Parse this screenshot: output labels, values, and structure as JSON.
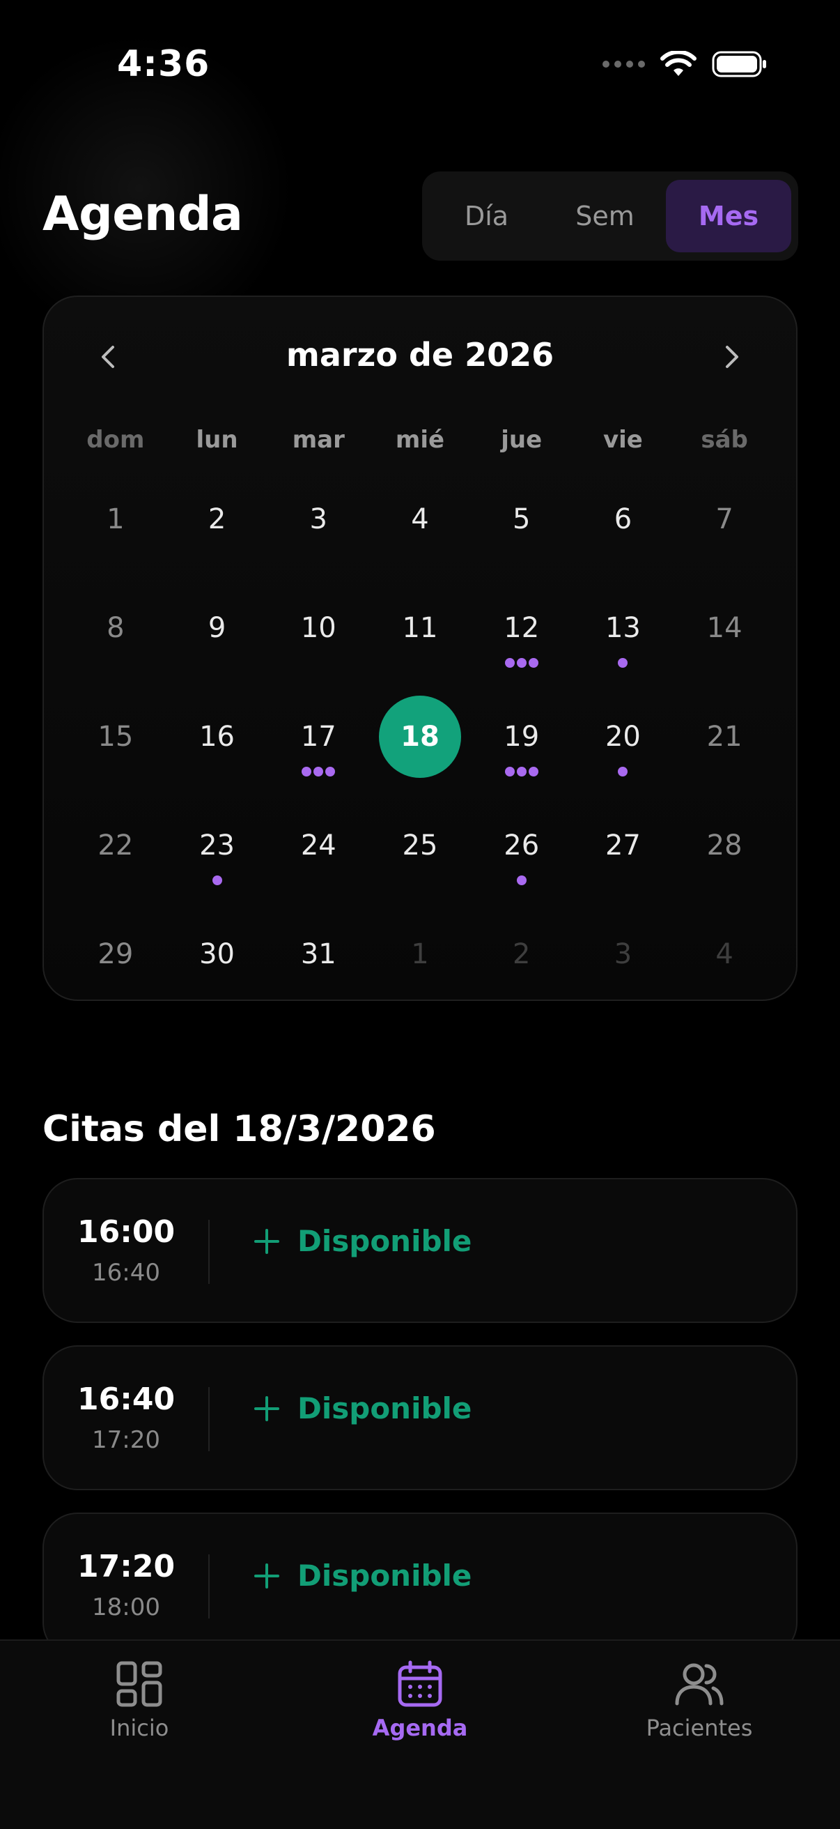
{
  "status_bar": {
    "time": "4:36"
  },
  "header": {
    "title": "Agenda",
    "view_modes": [
      {
        "label": "Día",
        "active": false
      },
      {
        "label": "Sem",
        "active": false
      },
      {
        "label": "Mes",
        "active": true
      }
    ]
  },
  "calendar": {
    "month_label": "marzo de 2026",
    "weekdays": [
      "dom",
      "lun",
      "mar",
      "mié",
      "jue",
      "vie",
      "sáb"
    ],
    "selected_day": 18,
    "weeks": [
      [
        {
          "d": "1",
          "type": "weekend"
        },
        {
          "d": "2"
        },
        {
          "d": "3"
        },
        {
          "d": "4"
        },
        {
          "d": "5"
        },
        {
          "d": "6"
        },
        {
          "d": "7",
          "type": "weekend"
        }
      ],
      [
        {
          "d": "8",
          "type": "weekend"
        },
        {
          "d": "9"
        },
        {
          "d": "10"
        },
        {
          "d": "11"
        },
        {
          "d": "12",
          "dots": 3
        },
        {
          "d": "13",
          "dots": 1
        },
        {
          "d": "14",
          "type": "weekend"
        }
      ],
      [
        {
          "d": "15",
          "type": "weekend"
        },
        {
          "d": "16"
        },
        {
          "d": "17",
          "dots": 3
        },
        {
          "d": "18",
          "selected": true
        },
        {
          "d": "19",
          "dots": 3
        },
        {
          "d": "20",
          "dots": 1
        },
        {
          "d": "21",
          "type": "weekend"
        }
      ],
      [
        {
          "d": "22",
          "type": "weekend"
        },
        {
          "d": "23",
          "dots": 1
        },
        {
          "d": "24"
        },
        {
          "d": "25"
        },
        {
          "d": "26",
          "dots": 1
        },
        {
          "d": "27"
        },
        {
          "d": "28",
          "type": "weekend"
        }
      ],
      [
        {
          "d": "29",
          "type": "weekend"
        },
        {
          "d": "30"
        },
        {
          "d": "31"
        },
        {
          "d": "1",
          "type": "other"
        },
        {
          "d": "2",
          "type": "other"
        },
        {
          "d": "3",
          "type": "other"
        },
        {
          "d": "4",
          "type": "other"
        }
      ]
    ],
    "dot_color": "#a96af0",
    "selected_color": "#12a27b"
  },
  "appointments": {
    "title": "Citas del 18/3/2026",
    "slots": [
      {
        "start": "16:00",
        "end": "16:40",
        "action": "Disponible"
      },
      {
        "start": "16:40",
        "end": "17:20",
        "action": "Disponible"
      },
      {
        "start": "17:20",
        "end": "18:00",
        "action": "Disponible"
      }
    ]
  },
  "tabbar": {
    "tabs": [
      {
        "label": "Inicio",
        "icon": "grid-icon",
        "active": false
      },
      {
        "label": "Agenda",
        "icon": "calendar-icon",
        "active": true
      },
      {
        "label": "Pacientes",
        "icon": "users-icon",
        "active": false
      }
    ]
  },
  "colors": {
    "accent_purple": "#a66af2",
    "accent_green": "#12a27b"
  }
}
